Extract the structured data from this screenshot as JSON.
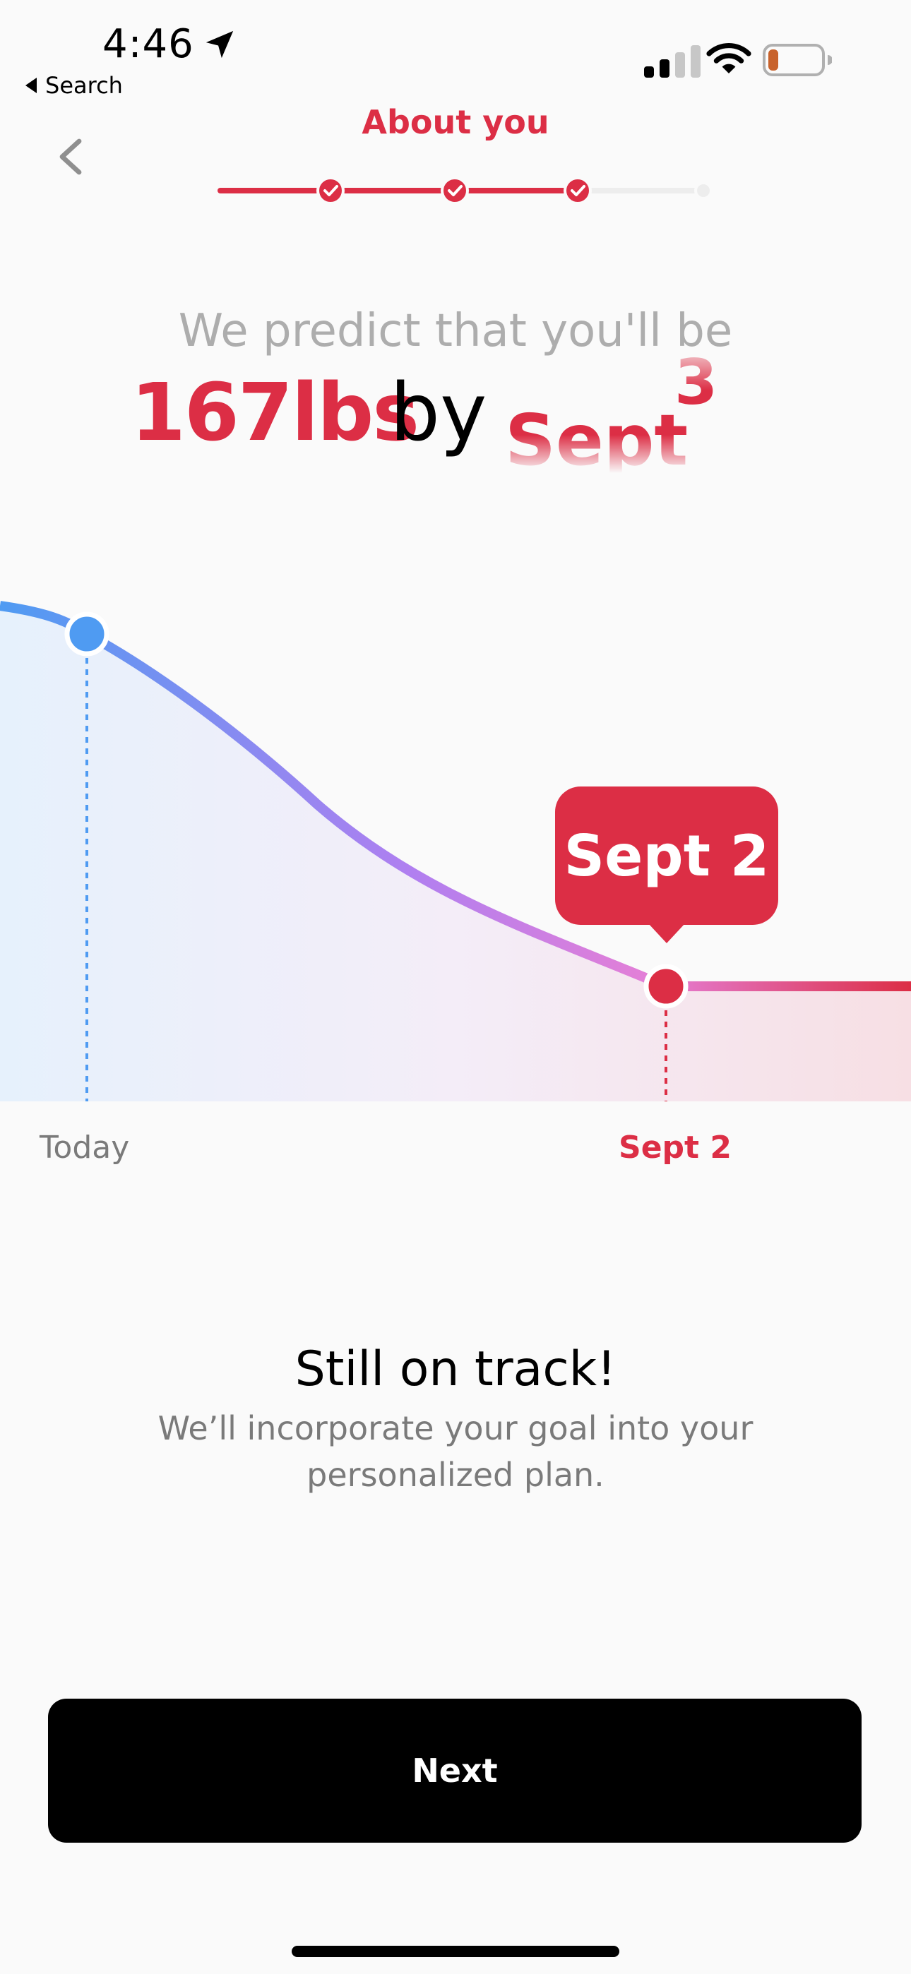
{
  "status_bar": {
    "time": "4:46",
    "back_label": "Search",
    "icons": [
      "location-arrow-icon",
      "cellular-signal-icon",
      "wifi-icon",
      "battery-icon"
    ]
  },
  "header": {
    "title": "About you",
    "progress": {
      "steps_total": 5,
      "steps_completed": 4
    }
  },
  "prediction": {
    "label": "We predict that you'll be",
    "weight": "167lbs",
    "by": "by",
    "date_roll_main": "Sept",
    "date_roll_digit": "3"
  },
  "chart": {
    "tooltip": "Sept 2",
    "x_labels": {
      "start": "Today",
      "goal": "Sept 2"
    }
  },
  "chart_data": {
    "type": "line",
    "x": [
      "Today",
      "Sept 2"
    ],
    "series": [
      {
        "values": [
          null,
          167
        ]
      }
    ],
    "annotations": [
      "Sept 2"
    ],
    "grid": false,
    "colors": {
      "start": "#4f9bf2",
      "mid": "#c27ee8",
      "end": "#dc2e45"
    }
  },
  "message": {
    "title": "Still on track!",
    "body": "We’ll incorporate your goal into your personalized plan."
  },
  "actions": {
    "next_label": "Next"
  },
  "colors": {
    "accent": "#dc2e45",
    "blue": "#4f9bf2",
    "background": "#fafafa",
    "button": "#000000",
    "muted_text": "#7a7a7a"
  }
}
